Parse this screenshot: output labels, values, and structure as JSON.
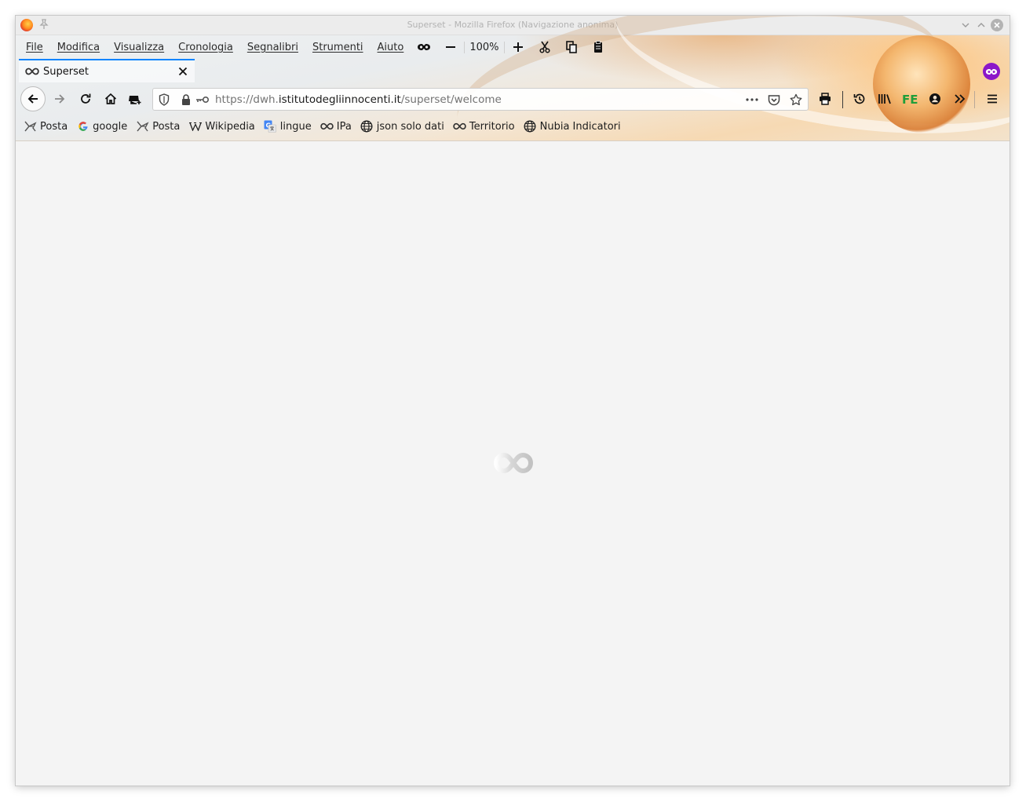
{
  "window": {
    "title": "Superset - Mozilla Firefox (Navigazione anonima)"
  },
  "menubar": {
    "items": [
      "File",
      "Modifica",
      "Visualizza",
      "Cronologia",
      "Segnalibri",
      "Strumenti",
      "Aiuto"
    ],
    "zoom_level": "100%"
  },
  "tabs": [
    {
      "title": "Superset",
      "favicon": "infinity-icon",
      "active": true
    }
  ],
  "navbar": {
    "url_prefix": "https://dwh.",
    "url_domain": "istitutodegliinnocenti.it",
    "url_path": "/superset/welcome",
    "extension_label": "FE"
  },
  "bookmarks": [
    {
      "label": "Posta",
      "icon": "mail-bird-icon"
    },
    {
      "label": "google",
      "icon": "google-icon"
    },
    {
      "label": "Posta",
      "icon": "mail-bird-icon"
    },
    {
      "label": "Wikipedia",
      "icon": "wikipedia-icon"
    },
    {
      "label": "lingue",
      "icon": "translate-icon"
    },
    {
      "label": "IPa",
      "icon": "infinity-icon"
    },
    {
      "label": "json solo dati",
      "icon": "globe-icon"
    },
    {
      "label": "Territorio",
      "icon": "infinity-icon"
    },
    {
      "label": "Nubia Indicatori",
      "icon": "globe-icon"
    }
  ],
  "colors": {
    "private_badge": "#8b17c9",
    "tab_accent": "#0a84ff",
    "content_bg": "#f4f4f4",
    "extension_green": "#1f9e3a"
  }
}
